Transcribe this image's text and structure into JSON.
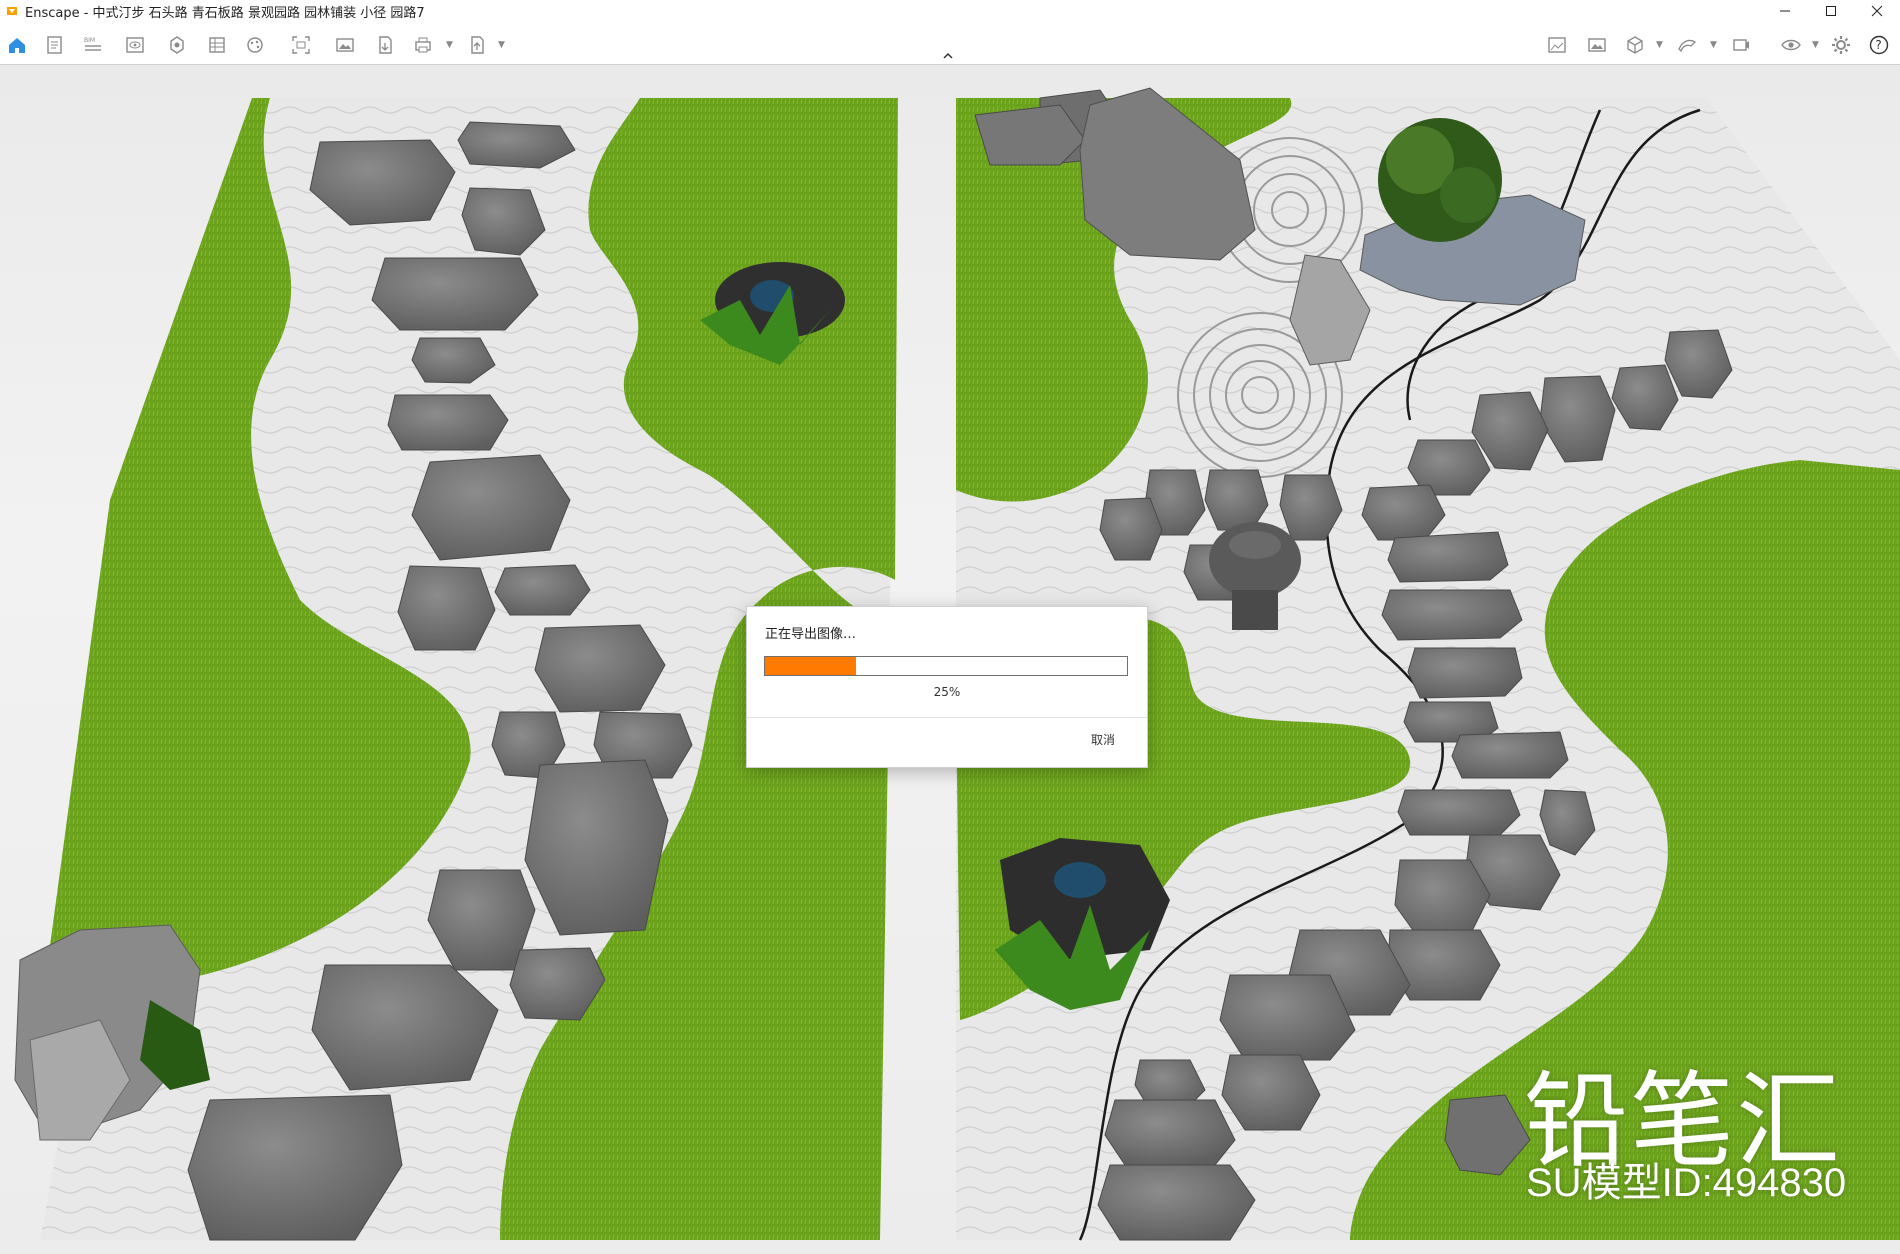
{
  "window": {
    "app_icon": "enscape-logo-icon",
    "title": "Enscape - 中式汀步 石头路 青石板路 景观园路 园林铺装 小径 园路7",
    "minimize_icon": "minimize-icon",
    "maximize_icon": "maximize-icon",
    "close_icon": "close-icon"
  },
  "toolbar": {
    "left_icons": [
      "home-icon",
      "document-icon",
      "bim-icon",
      "eye-icon",
      "asset-library-icon",
      "views-icon",
      "settings-icon",
      "screenshot-icon",
      "image-icon",
      "export-icon",
      "print-icon",
      "upload-icon"
    ],
    "right_icons": [
      "panorama-icon",
      "capture-icon",
      "cube-icon",
      "view-management-icon",
      "sync-icon",
      "eye-visibility-icon",
      "gear-icon",
      "help-icon"
    ],
    "collapse_icon": "chevron-up-icon"
  },
  "dialog": {
    "message": "正在导出图像…",
    "progress": 0.25,
    "progress_text": "25%",
    "cancel_label": "取消",
    "progress_color": "#ff7a00"
  },
  "overlay": {
    "brand": "铅笔汇",
    "model_id": "SU模型ID:494830"
  },
  "colors": {
    "grass": "#6da21d",
    "gravel": "#e6e6e6",
    "stone": "#727272",
    "accent": "#ff7a00"
  }
}
